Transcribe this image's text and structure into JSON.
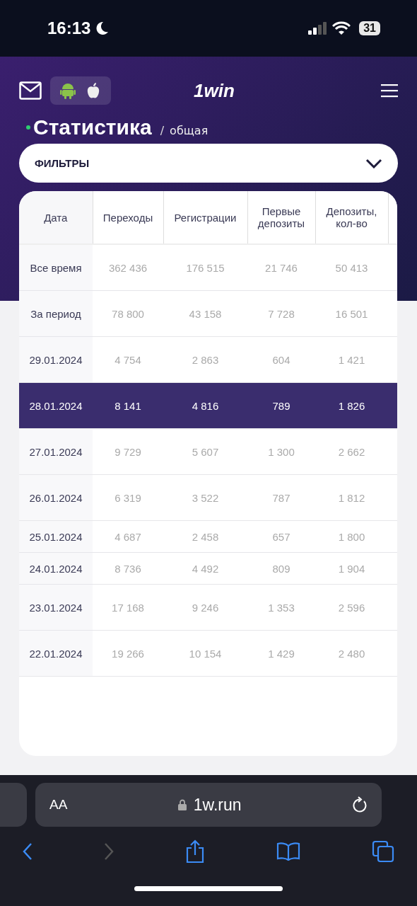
{
  "status_bar": {
    "time": "16:13",
    "battery": "31"
  },
  "header": {
    "logo": "1win"
  },
  "page": {
    "title": "Статистика",
    "separator": "/",
    "subtitle": "общая"
  },
  "filters": {
    "label": "ФИЛЬТРЫ",
    "expanded": false
  },
  "table": {
    "columns": [
      "Дата",
      "Переходы",
      "Регистрации",
      "Первые депозиты",
      "Депозиты, кол-во"
    ],
    "rows": [
      {
        "cells": [
          "Все время",
          "362 436",
          "176 515",
          "21 746",
          "50 413"
        ],
        "selected": false,
        "compact": false
      },
      {
        "cells": [
          "За период",
          "78 800",
          "43 158",
          "7 728",
          "16 501"
        ],
        "selected": false,
        "compact": false
      },
      {
        "cells": [
          "29.01.2024",
          "4 754",
          "2 863",
          "604",
          "1 421"
        ],
        "selected": false,
        "compact": false
      },
      {
        "cells": [
          "28.01.2024",
          "8 141",
          "4 816",
          "789",
          "1 826"
        ],
        "selected": true,
        "compact": false
      },
      {
        "cells": [
          "27.01.2024",
          "9 729",
          "5 607",
          "1 300",
          "2 662"
        ],
        "selected": false,
        "compact": false
      },
      {
        "cells": [
          "26.01.2024",
          "6 319",
          "3 522",
          "787",
          "1 812"
        ],
        "selected": false,
        "compact": false
      },
      {
        "cells": [
          "25.01.2024",
          "4 687",
          "2 458",
          "657",
          "1 800"
        ],
        "selected": false,
        "compact": true
      },
      {
        "cells": [
          "24.01.2024",
          "8 736",
          "4 492",
          "809",
          "1 904"
        ],
        "selected": false,
        "compact": true
      },
      {
        "cells": [
          "23.01.2024",
          "17 168",
          "9 246",
          "1 353",
          "2 596"
        ],
        "selected": false,
        "compact": false
      },
      {
        "cells": [
          "22.01.2024",
          "19 266",
          "10 154",
          "1 429",
          "2 480"
        ],
        "selected": false,
        "compact": false
      }
    ]
  },
  "browser": {
    "text_size": "AA",
    "url": "1w.run"
  }
}
